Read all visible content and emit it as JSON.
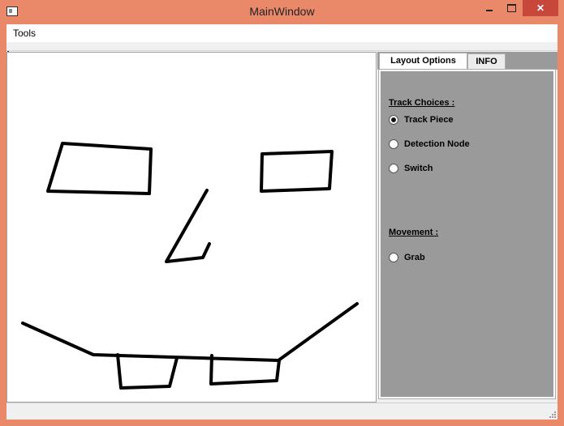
{
  "window": {
    "title": "MainWindow"
  },
  "menubar": {
    "items": [
      {
        "label": "Tools"
      }
    ]
  },
  "tabs": [
    {
      "label": "Layout Options",
      "active": true
    },
    {
      "label": "INFO",
      "active": false
    }
  ],
  "layout_options": {
    "track_choices_label": "Track Choices :",
    "track_choices": [
      {
        "label": "Track Piece",
        "checked": true
      },
      {
        "label": "Detection Node",
        "checked": false
      },
      {
        "label": "Switch",
        "checked": false
      }
    ],
    "movement_label": "Movement :",
    "movement": [
      {
        "label": "Grab",
        "checked": false
      }
    ]
  },
  "colors": {
    "frame": "#e9896a",
    "close_button": "#c7483b",
    "panel_background": "#9a9a9a",
    "drawing_stroke": "#000000"
  },
  "icons": {
    "app_icon": "app-window-icon",
    "minimize": "minimize-icon",
    "maximize": "maximize-icon",
    "close": "close-icon",
    "size_grip": "size-grip-icon"
  }
}
